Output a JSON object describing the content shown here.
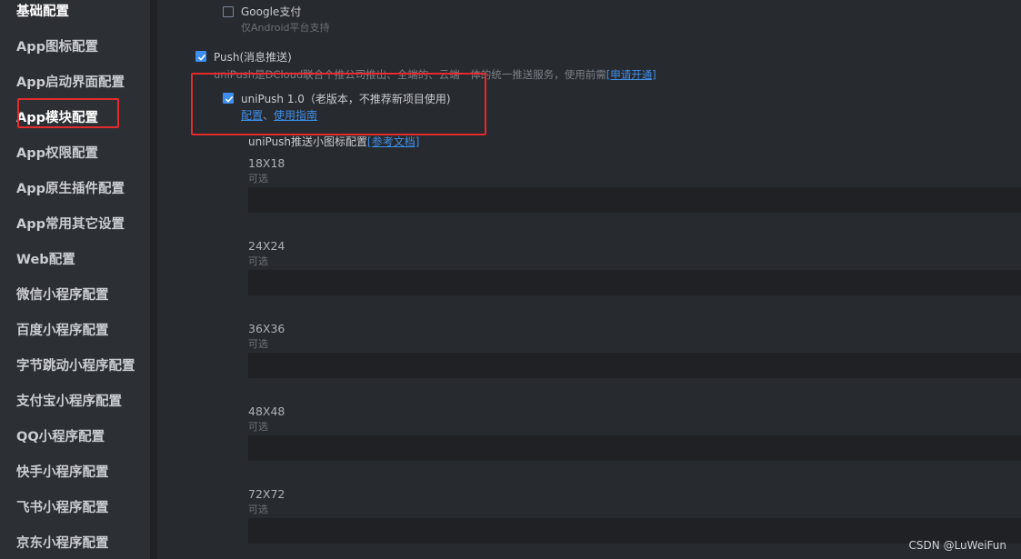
{
  "sidebar": {
    "items": [
      {
        "label": "基础配置"
      },
      {
        "label": "App图标配置"
      },
      {
        "label": "App启动界面配置"
      },
      {
        "label": "App模块配置"
      },
      {
        "label": "App权限配置"
      },
      {
        "label": "App原生插件配置"
      },
      {
        "label": "App常用其它设置"
      },
      {
        "label": "Web配置"
      },
      {
        "label": "微信小程序配置"
      },
      {
        "label": "百度小程序配置"
      },
      {
        "label": "字节跳动小程序配置"
      },
      {
        "label": "支付宝小程序配置"
      },
      {
        "label": "QQ小程序配置"
      },
      {
        "label": "快手小程序配置"
      },
      {
        "label": "飞书小程序配置"
      },
      {
        "label": "京东小程序配置"
      }
    ],
    "active_label": "App模块配置"
  },
  "google_pay": {
    "label": "Google支付",
    "note": "仅Android平台支持",
    "checked": false
  },
  "push": {
    "label": "Push(消息推送)",
    "checked": true,
    "description": "uniPush是DCloud联合个推公司推出、全端的、云端一体的统一推送服务，使用前需",
    "apply_link": "[申请开通]"
  },
  "unipush1": {
    "label": "uniPush 1.0（老版本，不推荐新项目使用)",
    "checked": true,
    "config_link": "配置",
    "separator": "、",
    "guide_link": "使用指南"
  },
  "small_icon": {
    "title": "uniPush推送小图标配置",
    "doc_link": "[参考文档]",
    "optional_label": "可选",
    "sizes": [
      "18X18",
      "24X24",
      "36X36",
      "48X48",
      "72X72"
    ]
  },
  "watermark": "CSDN @LuWeiFun",
  "colors": {
    "background": "#272a2e",
    "sidebar": "#2c2f33",
    "accent": "#3d8ef0",
    "link": "#3f8ee8",
    "highlight": "#e32b2b"
  }
}
